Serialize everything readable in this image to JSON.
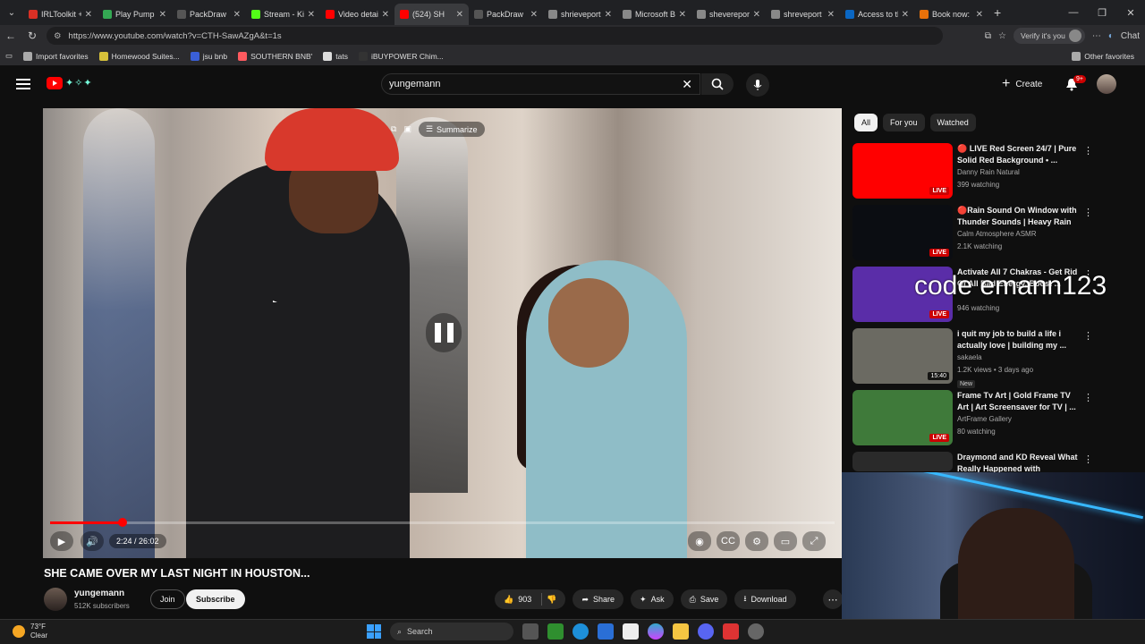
{
  "browser": {
    "tabs": [
      {
        "title": "IRLToolkit + D",
        "color": "#d93025",
        "active": false
      },
      {
        "title": "Play Pump C",
        "color": "#34a853",
        "active": false
      },
      {
        "title": "PackDraw",
        "color": "#555555",
        "active": false
      },
      {
        "title": "Stream - Kick",
        "color": "#53fc18",
        "active": false
      },
      {
        "title": "Video details",
        "color": "#ff0000",
        "active": false
      },
      {
        "title": "(524) SH",
        "color": "#ff0000",
        "active": true
      },
      {
        "title": "PackDraw",
        "color": "#555555",
        "active": false
      },
      {
        "title": "shrieveport re",
        "color": "#888888",
        "active": false
      },
      {
        "title": "Microsoft Bin",
        "color": "#888888",
        "active": false
      },
      {
        "title": "shevereport r",
        "color": "#888888",
        "active": false
      },
      {
        "title": "shreveport re",
        "color": "#888888",
        "active": false
      },
      {
        "title": "Access to thi",
        "color": "#0a66c2",
        "active": false
      },
      {
        "title": "Book now: D",
        "color": "#e8710a",
        "active": false
      }
    ],
    "url": "https://www.youtube.com/watch?v=CTH-SawAZgA&t=1s",
    "verify_label": "Verify it's you",
    "chat_label": "Chat",
    "bookmarks": [
      {
        "label": "Import favorites",
        "color": "#aaaaaa"
      },
      {
        "label": "Homewood Suites...",
        "color": "#d7c13a"
      },
      {
        "label": "jsu bnb",
        "color": "#3a5fd7"
      },
      {
        "label": "SOUTHERN BNB'",
        "color": "#ff5a5f"
      },
      {
        "label": "tats",
        "color": "#dddddd"
      },
      {
        "label": "iBUYPOWER Chim...",
        "color": "#333333"
      }
    ],
    "other_favorites": "Other favorites"
  },
  "youtube": {
    "search_query": "yungemann",
    "create_label": "Create",
    "notif_count": "9+",
    "player": {
      "summarize_label": "Summarize",
      "time_display": "2:24 / 26:02",
      "progress": 0.092
    },
    "video_title": "SHE CAME OVER MY LAST NIGHT IN HOUSTON...",
    "channel": {
      "name": "yungemann",
      "subscribers": "512K subscribers",
      "join_label": "Join",
      "subscribe_label": "Subscribe"
    },
    "actions": {
      "likes": "903",
      "share": "Share",
      "ask": "Ask",
      "save": "Save",
      "download": "Download"
    },
    "chips": [
      "All",
      "For you",
      "Watched"
    ],
    "recommendations": [
      {
        "title": "🔴 LIVE Red Screen 24/7 | Pure Solid Red Background • ...",
        "channel": "Danny Rain Natural",
        "meta": "399 watching",
        "badge": "LIVE",
        "thumb": "#ff0000"
      },
      {
        "title": "🔴Rain Sound On Window with Thunder Sounds | Heavy Rain ...",
        "channel": "Calm Atmosphere ASMR",
        "meta": "2.1K watching",
        "badge": "LIVE",
        "thumb": "#0b0d12"
      },
      {
        "title": "Activate All 7 Chakras - Get Rid Of All Bad Energy, Boost ...",
        "channel": "",
        "meta": "946 watching",
        "badge": "LIVE",
        "thumb": "#5a2da8"
      },
      {
        "title": "i quit my job to build a life i actually love | building my ...",
        "channel": "sakaela",
        "meta": "1.2K views • 3 days ago",
        "badge": "15:40",
        "thumb": "#6b6a62",
        "new": "New"
      },
      {
        "title": "Frame Tv Art | Gold Frame TV Art | Art Screensaver for TV | ...",
        "channel": "ArtFrame Gallery",
        "meta": "80 watching",
        "badge": "LIVE",
        "thumb": "#3f7a3a"
      },
      {
        "title": "Draymond and KD Reveal What Really Happened with Warriors...",
        "channel": "",
        "meta": "",
        "badge": "",
        "thumb": "#2a2a2a"
      }
    ]
  },
  "overlay": {
    "promo_text": "code emann123"
  },
  "taskbar": {
    "temp": "73°F",
    "condition": "Clear",
    "search_label": "Search"
  }
}
